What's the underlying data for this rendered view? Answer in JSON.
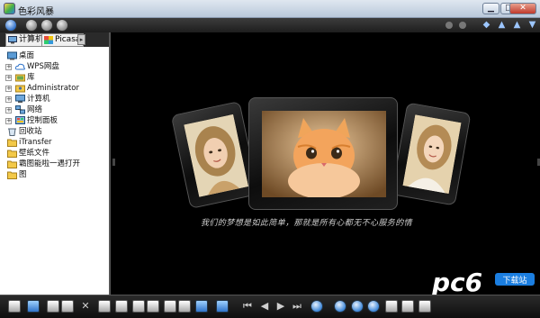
{
  "window": {
    "title": "色彩风暴",
    "buttons": {
      "minimize": "▁",
      "maximize": "□",
      "close": "✕"
    }
  },
  "sidebar": {
    "tabs": [
      {
        "label": "计算机",
        "icon": "computer-icon"
      },
      {
        "label": "Picasa",
        "icon": "picasa-icon"
      }
    ],
    "tab_scroll": "▸",
    "tree": [
      {
        "label": "桌面",
        "icon": "desktop-icon",
        "expandable": false
      },
      {
        "label": "WPS网盘",
        "icon": "cloud-icon",
        "expandable": true
      },
      {
        "label": "库",
        "icon": "library-folder-icon",
        "expandable": true
      },
      {
        "label": "Administrator",
        "icon": "user-folder-icon",
        "expandable": true
      },
      {
        "label": "计算机",
        "icon": "computer-icon",
        "expandable": true
      },
      {
        "label": "网络",
        "icon": "network-icon",
        "expandable": true
      },
      {
        "label": "控制面板",
        "icon": "control-panel-icon",
        "expandable": true
      },
      {
        "label": "回收站",
        "icon": "recycle-bin-icon",
        "expandable": false
      },
      {
        "label": "iTransfer",
        "icon": "folder-icon",
        "expandable": false
      },
      {
        "label": "壁纸文件",
        "icon": "folder-icon",
        "expandable": false
      },
      {
        "label": "霸图能啦一遇打开",
        "icon": "folder-icon",
        "expandable": false
      },
      {
        "label": "图",
        "icon": "folder-icon",
        "expandable": false
      }
    ]
  },
  "viewer": {
    "caption": "我们的梦想是如此简单，那就是所有心都无不心服务的情",
    "photos": [
      {
        "name": "girl-portrait-left",
        "colors": [
          "#e8d6b0",
          "#9d7b4a"
        ]
      },
      {
        "name": "orange-kitten",
        "colors": [
          "#f2a35a",
          "#7a4e1f"
        ]
      },
      {
        "name": "girl-portrait-right",
        "colors": [
          "#e9d3aa",
          "#a77f4b"
        ]
      }
    ]
  },
  "watermark": {
    "text": "pc6",
    "badge": "下载站"
  },
  "colors": {
    "accent": "#2f73c9",
    "toolbar": "#1e1e1e",
    "background": "#000000"
  }
}
